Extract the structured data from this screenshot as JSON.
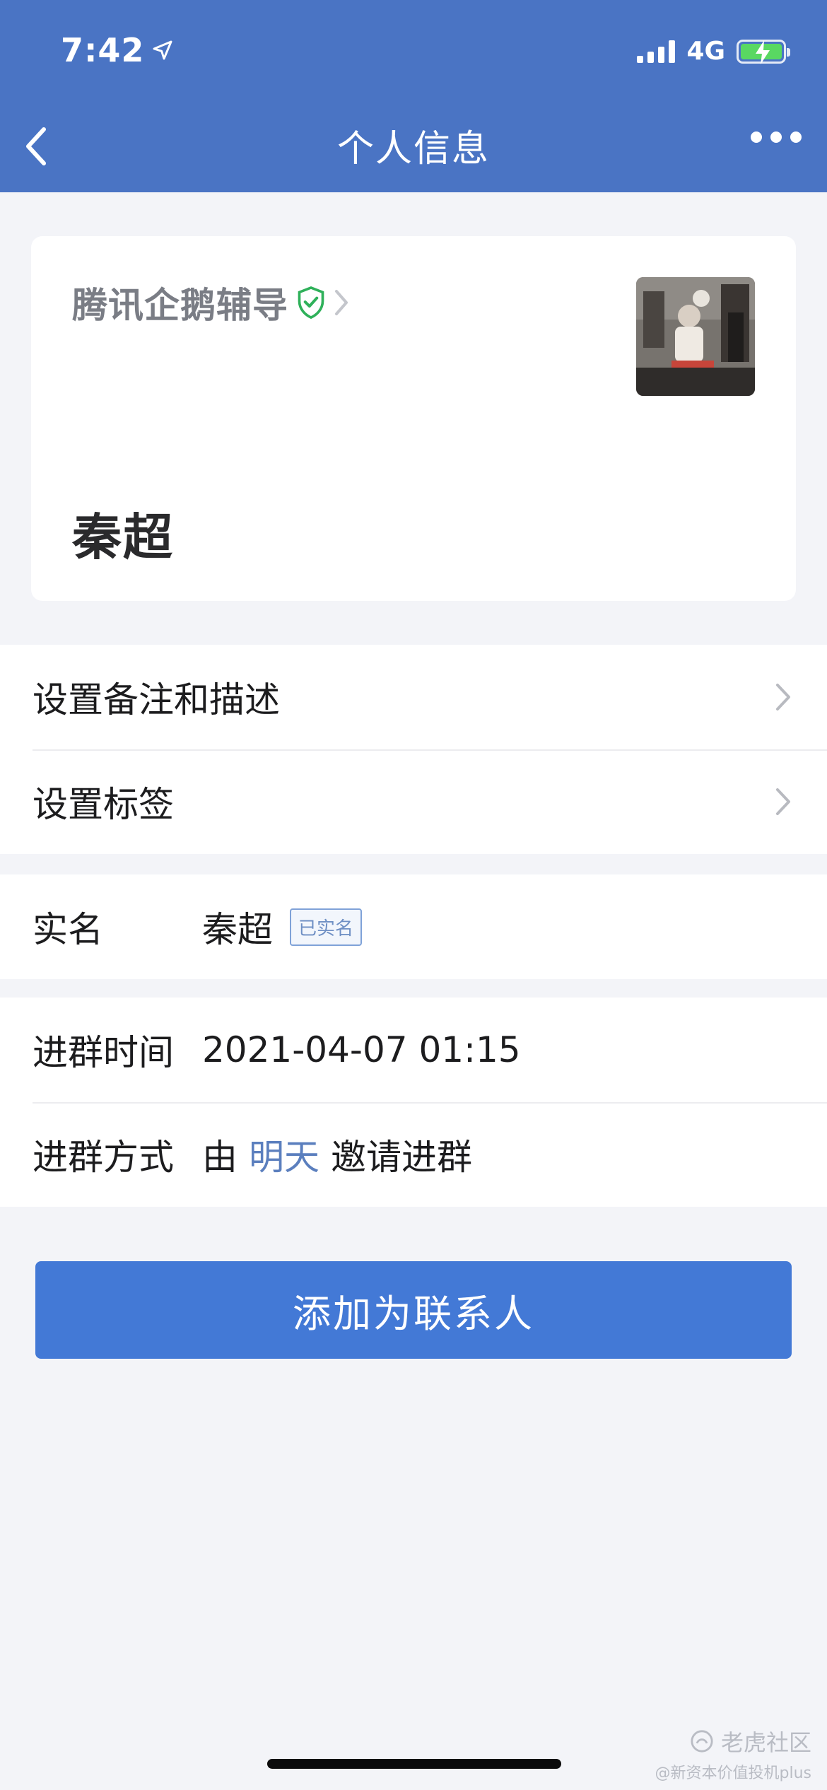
{
  "status_bar": {
    "time": "7:42",
    "network": "4G"
  },
  "nav": {
    "title": "个人信息"
  },
  "profile": {
    "org_name": "腾讯企鹅辅导",
    "name": "秦超"
  },
  "settings": [
    {
      "label": "设置备注和描述"
    },
    {
      "label": "设置标签"
    }
  ],
  "realname": {
    "label": "实名",
    "value": "秦超",
    "badge": "已实名"
  },
  "group_info": {
    "join_time_label": "进群时间",
    "join_time_value": "2021-04-07 01:15",
    "join_method_label": "进群方式",
    "join_method_prefix": "由",
    "join_method_inviter": "明天",
    "join_method_suffix": "邀请进群"
  },
  "primary_button": "添加为联系人",
  "watermark": {
    "line1": "老虎社区",
    "line2": "@新资本价值投机plus"
  },
  "colors": {
    "header": "#4a74c4",
    "button": "#4379d6",
    "link": "#5b7fbe",
    "verified": "#2fb15a"
  }
}
